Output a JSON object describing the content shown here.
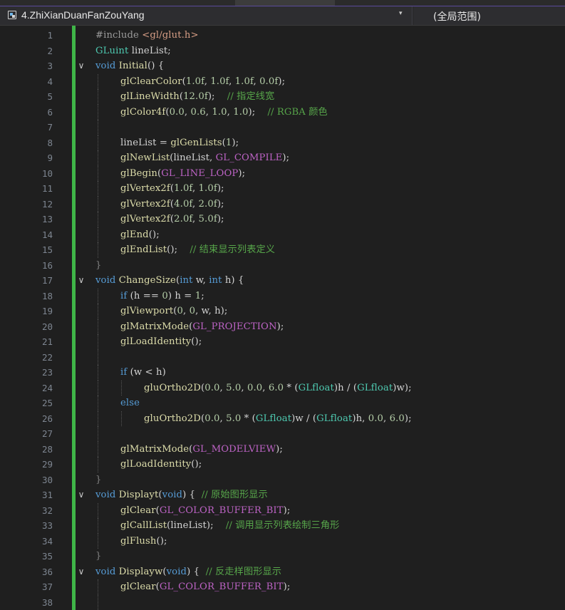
{
  "navbar": {
    "project": "4.ZhiXianDuanFanZouYang",
    "dropdown_glyph": "▾",
    "scope": "(全局范围)"
  },
  "colors": {
    "background": "#1f1f1f",
    "keyword": "#569cd6",
    "type": "#4ec9b0",
    "function": "#dcdcaa",
    "macro": "#bd63c5",
    "number": "#b5cea8",
    "comment": "#57a64a",
    "change_bar": "#3fb548"
  },
  "editor": {
    "lines": [
      {
        "n": "1",
        "fold": "",
        "indent": 0,
        "tokens": [
          {
            "t": "#include ",
            "c": "pp"
          },
          {
            "t": "<gl/glut.h>",
            "c": "s"
          }
        ]
      },
      {
        "n": "2",
        "fold": "",
        "indent": 0,
        "tokens": [
          {
            "t": "GLuint",
            "c": "t"
          },
          {
            "t": " lineList;",
            "c": "p"
          }
        ]
      },
      {
        "n": "3",
        "fold": "∨",
        "indent": 0,
        "tokens": [
          {
            "t": "void",
            "c": "k"
          },
          {
            "t": " ",
            "c": "p"
          },
          {
            "t": "Initial",
            "c": "f"
          },
          {
            "t": "() {",
            "c": "p"
          }
        ]
      },
      {
        "n": "4",
        "fold": "",
        "indent": 1,
        "tokens": [
          {
            "t": "glClearColor",
            "c": "f"
          },
          {
            "t": "(",
            "c": "p"
          },
          {
            "t": "1.0f",
            "c": "n"
          },
          {
            "t": ", ",
            "c": "p"
          },
          {
            "t": "1.0f",
            "c": "n"
          },
          {
            "t": ", ",
            "c": "p"
          },
          {
            "t": "1.0f",
            "c": "n"
          },
          {
            "t": ", ",
            "c": "p"
          },
          {
            "t": "0.0f",
            "c": "n"
          },
          {
            "t": ");",
            "c": "p"
          }
        ]
      },
      {
        "n": "5",
        "fold": "",
        "indent": 1,
        "tokens": [
          {
            "t": "glLineWidth",
            "c": "f"
          },
          {
            "t": "(",
            "c": "p"
          },
          {
            "t": "12.0f",
            "c": "n"
          },
          {
            "t": ");    ",
            "c": "p"
          },
          {
            "t": "// 指定线宽",
            "c": "c"
          }
        ]
      },
      {
        "n": "6",
        "fold": "",
        "indent": 1,
        "tokens": [
          {
            "t": "glColor4f",
            "c": "f"
          },
          {
            "t": "(",
            "c": "p"
          },
          {
            "t": "0.0",
            "c": "n"
          },
          {
            "t": ", ",
            "c": "p"
          },
          {
            "t": "0.6",
            "c": "n"
          },
          {
            "t": ", ",
            "c": "p"
          },
          {
            "t": "1.0",
            "c": "n"
          },
          {
            "t": ", ",
            "c": "p"
          },
          {
            "t": "1.0",
            "c": "n"
          },
          {
            "t": ");    ",
            "c": "p"
          },
          {
            "t": "// RGBA 颜色",
            "c": "c"
          }
        ]
      },
      {
        "n": "7",
        "fold": "",
        "indent": 1,
        "tokens": []
      },
      {
        "n": "8",
        "fold": "",
        "indent": 1,
        "tokens": [
          {
            "t": "lineList = ",
            "c": "p"
          },
          {
            "t": "glGenLists",
            "c": "f"
          },
          {
            "t": "(",
            "c": "p"
          },
          {
            "t": "1",
            "c": "n"
          },
          {
            "t": ");",
            "c": "p"
          }
        ]
      },
      {
        "n": "9",
        "fold": "",
        "indent": 1,
        "tokens": [
          {
            "t": "glNewList",
            "c": "f"
          },
          {
            "t": "(lineList, ",
            "c": "p"
          },
          {
            "t": "GL_COMPILE",
            "c": "m"
          },
          {
            "t": ");",
            "c": "p"
          }
        ]
      },
      {
        "n": "10",
        "fold": "",
        "indent": 1,
        "tokens": [
          {
            "t": "glBegin",
            "c": "f"
          },
          {
            "t": "(",
            "c": "p"
          },
          {
            "t": "GL_LINE_LOOP",
            "c": "m"
          },
          {
            "t": ");",
            "c": "p"
          }
        ]
      },
      {
        "n": "11",
        "fold": "",
        "indent": 1,
        "tokens": [
          {
            "t": "glVertex2f",
            "c": "f"
          },
          {
            "t": "(",
            "c": "p"
          },
          {
            "t": "1.0f",
            "c": "n"
          },
          {
            "t": ", ",
            "c": "p"
          },
          {
            "t": "1.0f",
            "c": "n"
          },
          {
            "t": ");",
            "c": "p"
          }
        ]
      },
      {
        "n": "12",
        "fold": "",
        "indent": 1,
        "tokens": [
          {
            "t": "glVertex2f",
            "c": "f"
          },
          {
            "t": "(",
            "c": "p"
          },
          {
            "t": "4.0f",
            "c": "n"
          },
          {
            "t": ", ",
            "c": "p"
          },
          {
            "t": "2.0f",
            "c": "n"
          },
          {
            "t": ");",
            "c": "p"
          }
        ]
      },
      {
        "n": "13",
        "fold": "",
        "indent": 1,
        "tokens": [
          {
            "t": "glVertex2f",
            "c": "f"
          },
          {
            "t": "(",
            "c": "p"
          },
          {
            "t": "2.0f",
            "c": "n"
          },
          {
            "t": ", ",
            "c": "p"
          },
          {
            "t": "5.0f",
            "c": "n"
          },
          {
            "t": ");",
            "c": "p"
          }
        ]
      },
      {
        "n": "14",
        "fold": "",
        "indent": 1,
        "tokens": [
          {
            "t": "glEnd",
            "c": "f"
          },
          {
            "t": "();",
            "c": "p"
          }
        ]
      },
      {
        "n": "15",
        "fold": "",
        "indent": 1,
        "tokens": [
          {
            "t": "glEndList",
            "c": "f"
          },
          {
            "t": "();    ",
            "c": "p"
          },
          {
            "t": "// 结束显示列表定义",
            "c": "c"
          }
        ]
      },
      {
        "n": "16",
        "fold": "",
        "indent": 0,
        "tokens": [
          {
            "t": "}",
            "c": "close-brace"
          }
        ]
      },
      {
        "n": "17",
        "fold": "∨",
        "indent": 0,
        "tokens": [
          {
            "t": "void",
            "c": "k"
          },
          {
            "t": " ",
            "c": "p"
          },
          {
            "t": "ChangeSize",
            "c": "f"
          },
          {
            "t": "(",
            "c": "p"
          },
          {
            "t": "int",
            "c": "k"
          },
          {
            "t": " w, ",
            "c": "p"
          },
          {
            "t": "int",
            "c": "k"
          },
          {
            "t": " h) {",
            "c": "p"
          }
        ]
      },
      {
        "n": "18",
        "fold": "",
        "indent": 1,
        "tokens": [
          {
            "t": "if",
            "c": "k"
          },
          {
            "t": " (h == ",
            "c": "p"
          },
          {
            "t": "0",
            "c": "n"
          },
          {
            "t": ") h = ",
            "c": "p"
          },
          {
            "t": "1",
            "c": "n"
          },
          {
            "t": ";",
            "c": "p"
          }
        ]
      },
      {
        "n": "19",
        "fold": "",
        "indent": 1,
        "tokens": [
          {
            "t": "glViewport",
            "c": "f"
          },
          {
            "t": "(",
            "c": "p"
          },
          {
            "t": "0",
            "c": "n"
          },
          {
            "t": ", ",
            "c": "p"
          },
          {
            "t": "0",
            "c": "n"
          },
          {
            "t": ", w, h);",
            "c": "p"
          }
        ]
      },
      {
        "n": "20",
        "fold": "",
        "indent": 1,
        "tokens": [
          {
            "t": "glMatrixMode",
            "c": "f"
          },
          {
            "t": "(",
            "c": "p"
          },
          {
            "t": "GL_PROJECTION",
            "c": "m"
          },
          {
            "t": ");",
            "c": "p"
          }
        ]
      },
      {
        "n": "21",
        "fold": "",
        "indent": 1,
        "tokens": [
          {
            "t": "glLoadIdentity",
            "c": "f"
          },
          {
            "t": "();",
            "c": "p"
          }
        ]
      },
      {
        "n": "22",
        "fold": "",
        "indent": 1,
        "tokens": []
      },
      {
        "n": "23",
        "fold": "",
        "indent": 1,
        "tokens": [
          {
            "t": "if",
            "c": "k"
          },
          {
            "t": " (w < h)",
            "c": "p"
          }
        ]
      },
      {
        "n": "24",
        "fold": "",
        "indent": 2,
        "tokens": [
          {
            "t": "gluOrtho2D",
            "c": "f"
          },
          {
            "t": "(",
            "c": "p"
          },
          {
            "t": "0.0",
            "c": "n"
          },
          {
            "t": ", ",
            "c": "p"
          },
          {
            "t": "5.0",
            "c": "n"
          },
          {
            "t": ", ",
            "c": "p"
          },
          {
            "t": "0.0",
            "c": "n"
          },
          {
            "t": ", ",
            "c": "p"
          },
          {
            "t": "6.0",
            "c": "n"
          },
          {
            "t": " * (",
            "c": "p"
          },
          {
            "t": "GLfloat",
            "c": "t"
          },
          {
            "t": ")h / (",
            "c": "p"
          },
          {
            "t": "GLfloat",
            "c": "t"
          },
          {
            "t": ")w);",
            "c": "p"
          }
        ]
      },
      {
        "n": "25",
        "fold": "",
        "indent": 1,
        "tokens": [
          {
            "t": "else",
            "c": "k"
          }
        ]
      },
      {
        "n": "26",
        "fold": "",
        "indent": 2,
        "tokens": [
          {
            "t": "gluOrtho2D",
            "c": "f"
          },
          {
            "t": "(",
            "c": "p"
          },
          {
            "t": "0.0",
            "c": "n"
          },
          {
            "t": ", ",
            "c": "p"
          },
          {
            "t": "5.0",
            "c": "n"
          },
          {
            "t": " * (",
            "c": "p"
          },
          {
            "t": "GLfloat",
            "c": "t"
          },
          {
            "t": ")w / (",
            "c": "p"
          },
          {
            "t": "GLfloat",
            "c": "t"
          },
          {
            "t": ")h, ",
            "c": "p"
          },
          {
            "t": "0.0",
            "c": "n"
          },
          {
            "t": ", ",
            "c": "p"
          },
          {
            "t": "6.0",
            "c": "n"
          },
          {
            "t": ");",
            "c": "p"
          }
        ]
      },
      {
        "n": "27",
        "fold": "",
        "indent": 1,
        "tokens": []
      },
      {
        "n": "28",
        "fold": "",
        "indent": 1,
        "tokens": [
          {
            "t": "glMatrixMode",
            "c": "f"
          },
          {
            "t": "(",
            "c": "p"
          },
          {
            "t": "GL_MODELVIEW",
            "c": "m"
          },
          {
            "t": ");",
            "c": "p"
          }
        ]
      },
      {
        "n": "29",
        "fold": "",
        "indent": 1,
        "tokens": [
          {
            "t": "glLoadIdentity",
            "c": "f"
          },
          {
            "t": "();",
            "c": "p"
          }
        ]
      },
      {
        "n": "30",
        "fold": "",
        "indent": 0,
        "tokens": [
          {
            "t": "}",
            "c": "close-brace"
          }
        ]
      },
      {
        "n": "31",
        "fold": "∨",
        "indent": 0,
        "tokens": [
          {
            "t": "void",
            "c": "k"
          },
          {
            "t": " ",
            "c": "p"
          },
          {
            "t": "Displayt",
            "c": "f"
          },
          {
            "t": "(",
            "c": "p"
          },
          {
            "t": "void",
            "c": "k"
          },
          {
            "t": ") {  ",
            "c": "p"
          },
          {
            "t": "// 原始图形显示",
            "c": "c"
          }
        ]
      },
      {
        "n": "32",
        "fold": "",
        "indent": 1,
        "tokens": [
          {
            "t": "glClear",
            "c": "f"
          },
          {
            "t": "(",
            "c": "p"
          },
          {
            "t": "GL_COLOR_BUFFER_BIT",
            "c": "m"
          },
          {
            "t": ");",
            "c": "p"
          }
        ]
      },
      {
        "n": "33",
        "fold": "",
        "indent": 1,
        "tokens": [
          {
            "t": "glCallList",
            "c": "f"
          },
          {
            "t": "(lineList);    ",
            "c": "p"
          },
          {
            "t": "// 调用显示列表绘制三角形",
            "c": "c"
          }
        ]
      },
      {
        "n": "34",
        "fold": "",
        "indent": 1,
        "tokens": [
          {
            "t": "glFlush",
            "c": "f"
          },
          {
            "t": "();",
            "c": "p"
          }
        ]
      },
      {
        "n": "35",
        "fold": "",
        "indent": 0,
        "tokens": [
          {
            "t": "}",
            "c": "close-brace"
          }
        ]
      },
      {
        "n": "36",
        "fold": "∨",
        "indent": 0,
        "tokens": [
          {
            "t": "void",
            "c": "k"
          },
          {
            "t": " ",
            "c": "p"
          },
          {
            "t": "Displayw",
            "c": "f"
          },
          {
            "t": "(",
            "c": "p"
          },
          {
            "t": "void",
            "c": "k"
          },
          {
            "t": ") {  ",
            "c": "p"
          },
          {
            "t": "// 反走样图形显示",
            "c": "c"
          }
        ]
      },
      {
        "n": "37",
        "fold": "",
        "indent": 1,
        "tokens": [
          {
            "t": "glClear",
            "c": "f"
          },
          {
            "t": "(",
            "c": "p"
          },
          {
            "t": "GL_COLOR_BUFFER_BIT",
            "c": "m"
          },
          {
            "t": ");",
            "c": "p"
          }
        ]
      },
      {
        "n": "38",
        "fold": "",
        "indent": 1,
        "tokens": []
      }
    ]
  }
}
